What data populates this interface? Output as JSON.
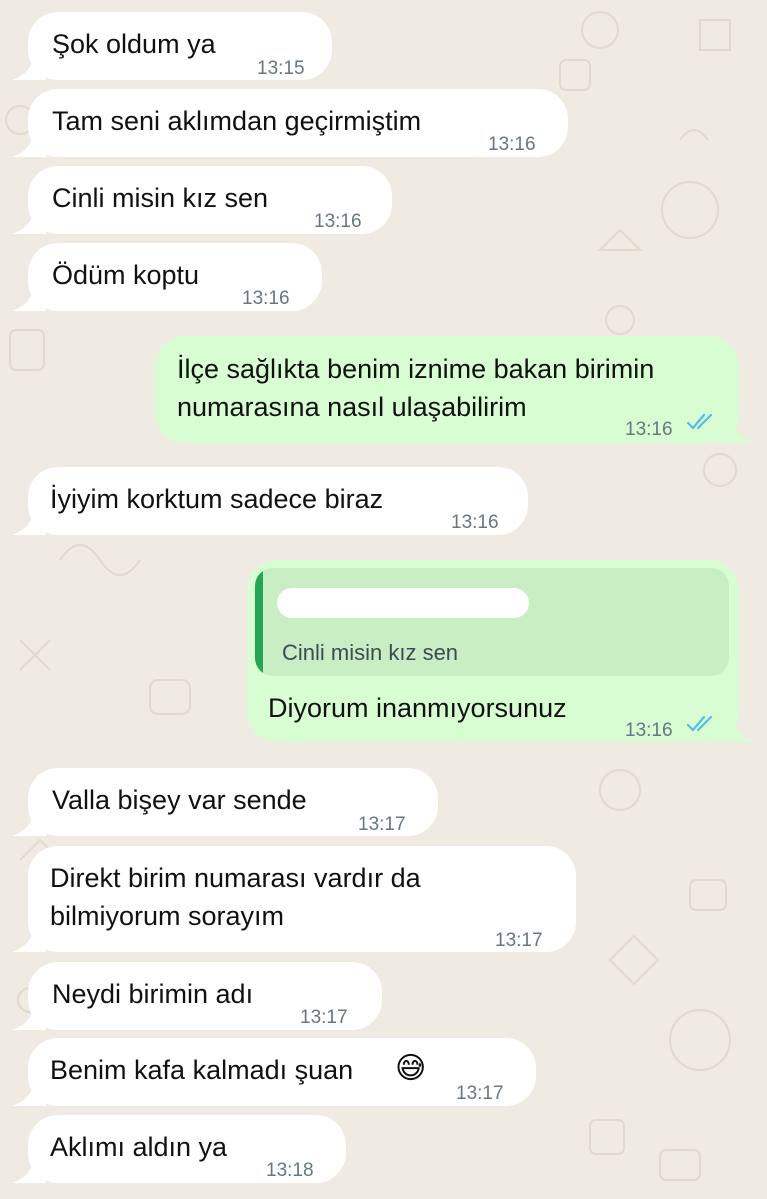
{
  "colors": {
    "wallpaper": "#efeae2",
    "incoming_bubble": "#ffffff",
    "outgoing_bubble": "#d9fdd3",
    "quote_background": "#c9eec4",
    "quote_bar": "#25a556",
    "timestamp": "#667781",
    "read_ticks": "#53bdeb"
  },
  "icons": {
    "read_receipt": "double-check-icon",
    "emoji": "grinning-face-with-sweat-emoji"
  },
  "messages": [
    {
      "direction": "incoming",
      "text": "Şok oldum ya",
      "time": "13:15"
    },
    {
      "direction": "incoming",
      "text": "Tam seni aklımdan geçirmiştim",
      "time": "13:16"
    },
    {
      "direction": "incoming",
      "text": "Cinli misin kız sen",
      "time": "13:16"
    },
    {
      "direction": "incoming",
      "text": "Ödüm koptu",
      "time": "13:16"
    },
    {
      "direction": "outgoing",
      "lines": [
        "İlçe sağlıkta benim iznime bakan birimin",
        "numarasına nasıl ulaşabilirim"
      ],
      "time": "13:16",
      "status": "read"
    },
    {
      "direction": "incoming",
      "text": "İyiyim korktum sadece biraz",
      "time": "13:16"
    },
    {
      "direction": "outgoing",
      "quoted_text": "Cinli misin kız sen",
      "quoted_author_hidden": true,
      "text": "Diyorum inanmıyorsunuz",
      "time": "13:16",
      "status": "read"
    },
    {
      "direction": "incoming",
      "text": "Valla bişey var sende",
      "time": "13:17"
    },
    {
      "direction": "incoming",
      "lines": [
        "Direkt birim numarası vardır da",
        "bilmiyorum sorayım"
      ],
      "time": "13:17"
    },
    {
      "direction": "incoming",
      "text": "Neydi birimin adı",
      "time": "13:17"
    },
    {
      "direction": "incoming",
      "text": "Benim kafa kalmadı şuan",
      "time": "13:17",
      "emoji": "😅"
    },
    {
      "direction": "incoming",
      "text": "Aklımı aldın ya",
      "time": "13:18"
    }
  ]
}
